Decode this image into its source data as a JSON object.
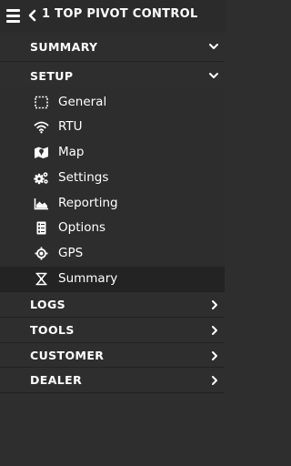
{
  "header": {
    "title": "1 TOP PIVOT CONTROL"
  },
  "sections": {
    "summary": "SUMMARY",
    "setup": "SETUP",
    "logs": "LOGS",
    "tools": "TOOLS",
    "customer": "CUSTOMER",
    "dealer": "DEALER"
  },
  "setup_items": {
    "general": "General",
    "rtu": "RTU",
    "map": "Map",
    "settings": "Settings",
    "reporting": "Reporting",
    "options": "Options",
    "gps": "GPS",
    "summary": "Summary"
  },
  "icons": {
    "menu": "hamburger-menu-icon",
    "back": "chevron-left-icon",
    "general": "dashed-square-icon",
    "rtu": "wifi-icon",
    "map": "map-icon",
    "settings": "gears-icon",
    "reporting": "area-chart-icon",
    "options": "list-options-icon",
    "gps": "gps-crosshair-icon",
    "summary": "pivot-summary-icon"
  },
  "colors": {
    "background": "#2e2e2e",
    "header": "#2b2b2b",
    "active_row": "#232323",
    "text": "#ffffff"
  }
}
